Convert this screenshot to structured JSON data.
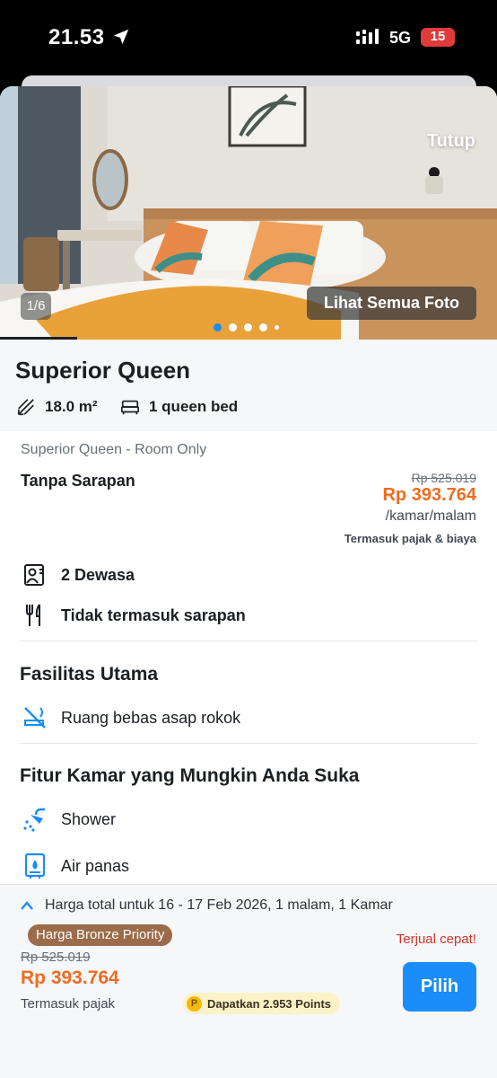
{
  "status_bar": {
    "time": "21.53",
    "network": "5G",
    "battery": "15"
  },
  "photo": {
    "close_label": "Tutup",
    "counter": "1/6",
    "see_all_label": "Lihat Semua Foto"
  },
  "room": {
    "title": "Superior Queen",
    "size": "18.0 m²",
    "bed": "1 queen bed"
  },
  "rate": {
    "name": "Superior Queen - Room Only",
    "meal": "Tanpa Sarapan",
    "price_original": "Rp 525.019",
    "price_final": "Rp 393.764",
    "unit": "/kamar/malam",
    "tax_note": "Termasuk pajak & biaya"
  },
  "occupancy": {
    "guests": "2 Dewasa",
    "breakfast": "Tidak termasuk sarapan"
  },
  "facilities": {
    "title": "Fasilitas Utama",
    "items": [
      "Ruang bebas asap rokok"
    ]
  },
  "features": {
    "title": "Fitur Kamar yang Mungkin Anda Suka",
    "items": [
      "Shower",
      "Air panas"
    ]
  },
  "bottom_bar": {
    "total_label": "Harga total untuk 16 - 17 Feb 2026, 1 malam, 1 Kamar",
    "badge": "Harga Bronze Priority",
    "sold_fast": "Terjual cepat!",
    "price_original": "Rp 525.019",
    "price_final": "Rp 393.764",
    "tax_note": "Termasuk pajak",
    "points": "Dapatkan 2.953 Points",
    "points_icon": "P",
    "choose_label": "Pilih"
  },
  "colors": {
    "accent": "#1a8dfa",
    "price": "#f06b1f",
    "badge": "#9b6b4a",
    "alert": "#d9332b"
  }
}
